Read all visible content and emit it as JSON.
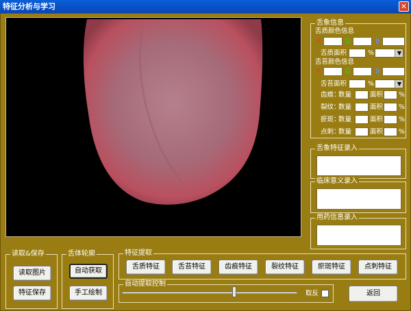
{
  "window": {
    "title": "特征分析与学习",
    "close_glyph": "✕"
  },
  "tongue_info": {
    "legend": "舌象信息",
    "coat_color_heading": "舌质颜色信息",
    "coating_color_heading": "舌苔颜色信息",
    "r": "R",
    "g": "G",
    "b": "B",
    "body_area_label": "舌质面积",
    "coating_area_label": "舌苔面积",
    "percent": "%",
    "count_label": "数量",
    "area_label": "面积",
    "features": [
      "齿痕：",
      "裂纹：",
      "瘀斑：",
      "点刺："
    ],
    "combo_arrow": "▼"
  },
  "feature_input": {
    "legend": "舌象特征录入"
  },
  "clinical_input": {
    "legend": "临床意义录入"
  },
  "medication_input": {
    "legend": "用药信息录入"
  },
  "read_save": {
    "legend": "读取&保存",
    "read_button": "读取图片",
    "save_button": "特征保存"
  },
  "contour": {
    "legend": "舌体轮廓",
    "auto_button": "自动获取",
    "manual_button": "手工绘制"
  },
  "extract": {
    "legend": "特征提取",
    "buttons": [
      "舌质特征",
      "舌苔特征",
      "齿痕特征",
      "裂纹特征",
      "瘀斑特征",
      "点刺特征"
    ]
  },
  "auto_control": {
    "legend": "自动提取控制",
    "slider_value": 0.64,
    "invert_label": "取反",
    "invert_checked": false
  },
  "return_button": "返回"
}
